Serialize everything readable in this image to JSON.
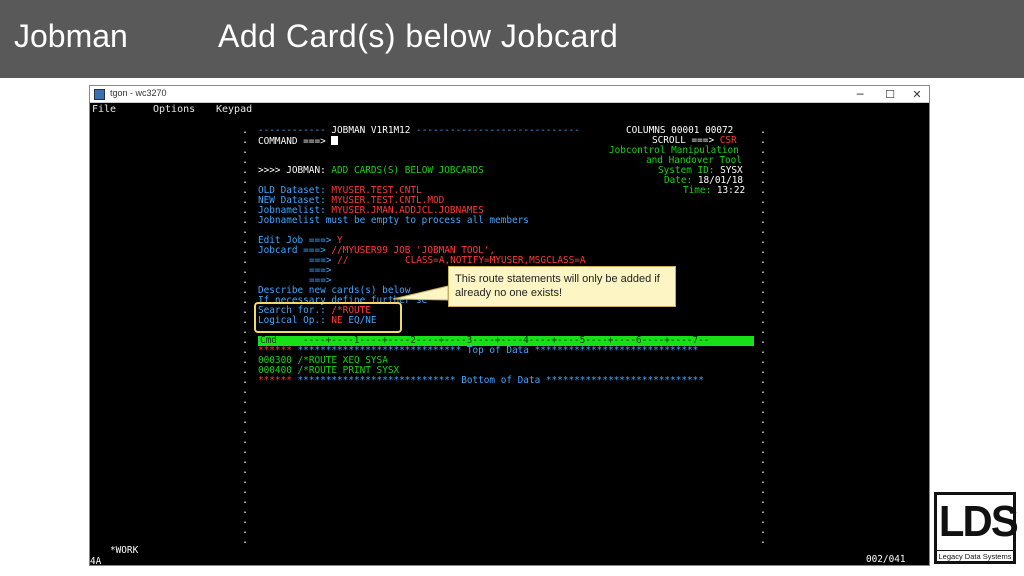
{
  "slide": {
    "title_left": "Jobman",
    "title_main": "Add Card(s) below Jobcard"
  },
  "window": {
    "title": "tgon - wc3270",
    "min": "─",
    "max": "☐",
    "close": "✕"
  },
  "menu": {
    "file": "File",
    "options": "Options",
    "keypad": "Keypad"
  },
  "terminal": {
    "header_rule_left": "------------",
    "header_title": "JOBMAN V1R1M12",
    "header_rule_right": "-----------------------------",
    "columns_label": "COLUMNS",
    "columns_from": "00001",
    "columns_to": "00072",
    "command_label": "COMMAND ===>",
    "scroll_label": "SCROLL ===>",
    "scroll_value": "CSR",
    "tool_line1": "Jobcontrol Manipulation",
    "tool_line2": "and Handover Tool",
    "sysid_label": "System ID:",
    "sysid_value": "SYSX",
    "date_label": "Date:",
    "date_value": "18/01/18",
    "time_label": "Time:",
    "time_value": "13:22",
    "prompt_prefix": ">>>> JOBMAN:",
    "prompt_text": "ADD CARDS(S) BELOW JOBCARDS",
    "old_label": "OLD Dataset:",
    "old_value": "MYUSER.TEST.CNTL",
    "new_label": "NEW Dataset:",
    "new_value": "MYUSER.TEST.CNTL.MOD",
    "jobnamelist_label": "Jobnamelist:",
    "jobnamelist_value": "MYUSER.JMAN.ADDJCL.JOBNAMES",
    "jobnamelist_note": "Jobnamelist must be empty to process all members",
    "editjob_label": "Edit Job ===>",
    "editjob_value": "Y",
    "jobcard_label": "Jobcard ===>",
    "jobcard_line1": "//MYUSER99 JOB 'JOBMAN TOOL',",
    "jobcard_arrow": "===>",
    "jobcard_line2": "//          CLASS=A,NOTIFY=MYUSER,MSGCLASS=A",
    "describe_line": "Describe new cards(s) below",
    "necessary_line": "If necessary define further se",
    "search_label": "Search for.:",
    "search_value": "/*ROUTE",
    "logical_label": "Logical Op.:",
    "logical_ne": "NE",
    "logical_options": "EQ/NE",
    "cmd_field": "Cmd",
    "ruler": "----+----1----+----2----+----3----+----4----+----5----+----6----+----7--",
    "stars": "******",
    "top_of_data": "***************************** Top of Data *****************************",
    "line1_num": "000300",
    "line1_text": "/*ROUTE XEQ SYSA",
    "line2_num": "000400",
    "line2_text": "/*ROUTE PRINT SYSX",
    "bottom_of_data": "**************************** Bottom of Data ****************************",
    "status_work": "*WORK",
    "status_left": "4A",
    "status_right": "002/041"
  },
  "callout": {
    "text": "This route statements will only be added if already no one exists!"
  },
  "logo": {
    "main": "LDS",
    "sub": "Legacy Data Systems"
  },
  "colors": {
    "header_bg": "#595959",
    "term_green": "#19d319",
    "term_blue": "#3fa6ff",
    "term_red": "#ff3a3a",
    "highlight": "#f3d86a",
    "callout_bg": "#fdf5c4"
  }
}
